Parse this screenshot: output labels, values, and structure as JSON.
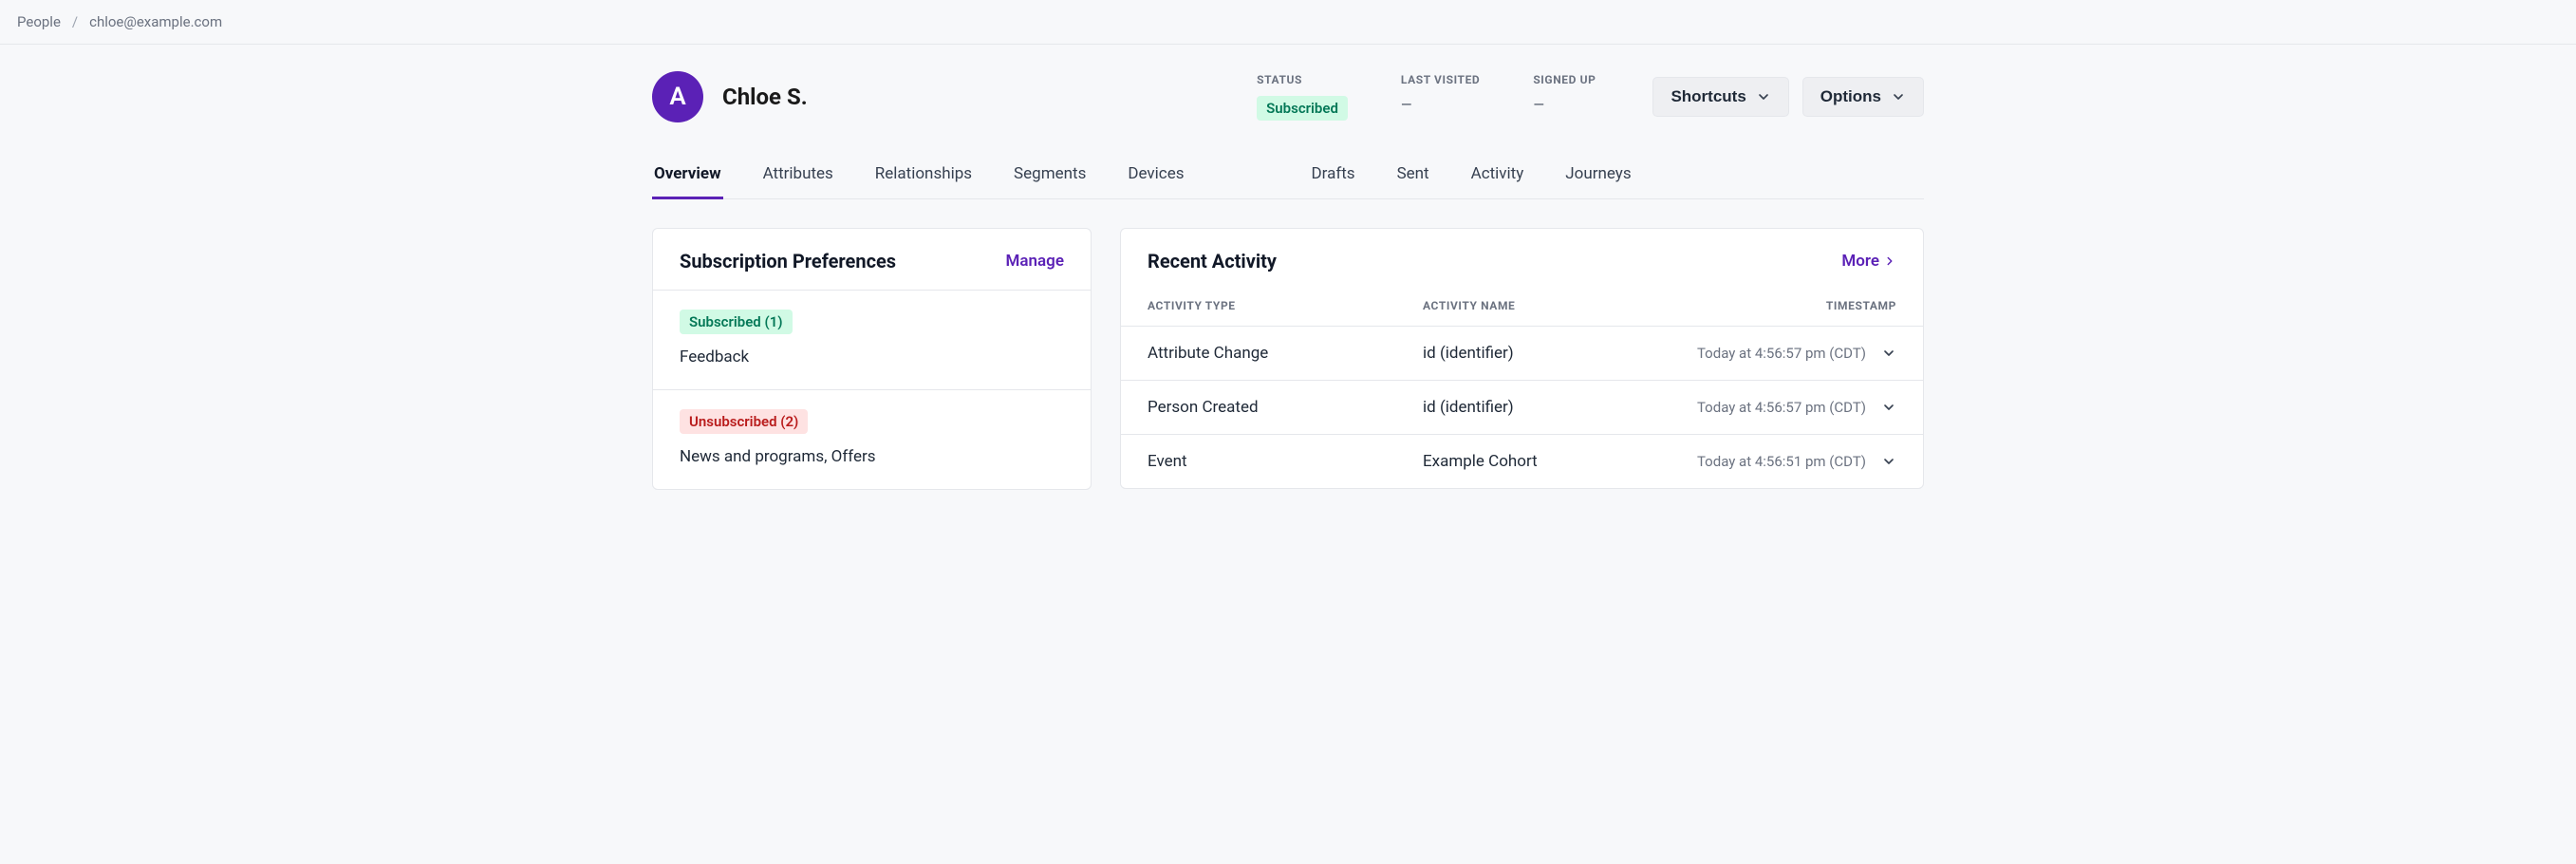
{
  "breadcrumb": {
    "parent": "People",
    "current": "chloe@example.com"
  },
  "person": {
    "avatar_letter": "A",
    "name": "Chloe S."
  },
  "meta": {
    "status_label": "STATUS",
    "status_value": "Subscribed",
    "last_visited_label": "LAST VISITED",
    "last_visited_value": "—",
    "signed_up_label": "SIGNED UP",
    "signed_up_value": "—"
  },
  "buttons": {
    "shortcuts": "Shortcuts",
    "options": "Options"
  },
  "tabs": [
    {
      "label": "Overview",
      "active": true
    },
    {
      "label": "Attributes",
      "active": false
    },
    {
      "label": "Relationships",
      "active": false
    },
    {
      "label": "Segments",
      "active": false
    },
    {
      "label": "Devices",
      "active": false
    },
    {
      "label": "Drafts",
      "active": false
    },
    {
      "label": "Sent",
      "active": false
    },
    {
      "label": "Activity",
      "active": false
    },
    {
      "label": "Journeys",
      "active": false
    }
  ],
  "subscription": {
    "title": "Subscription Preferences",
    "manage": "Manage",
    "subscribed_badge": "Subscribed (1)",
    "subscribed_list": "Feedback",
    "unsubscribed_badge": "Unsubscribed (2)",
    "unsubscribed_list": "News and programs, Offers"
  },
  "activity": {
    "title": "Recent Activity",
    "more": "More",
    "col_type": "ACTIVITY TYPE",
    "col_name": "ACTIVITY NAME",
    "col_time": "TIMESTAMP",
    "rows": [
      {
        "type": "Attribute Change",
        "name": "id (identifier)",
        "time": "Today at 4:56:57 pm (CDT)"
      },
      {
        "type": "Person Created",
        "name": "id (identifier)",
        "time": "Today at 4:56:57 pm (CDT)"
      },
      {
        "type": "Event",
        "name": "Example Cohort",
        "time": "Today at 4:56:51 pm (CDT)"
      }
    ]
  }
}
